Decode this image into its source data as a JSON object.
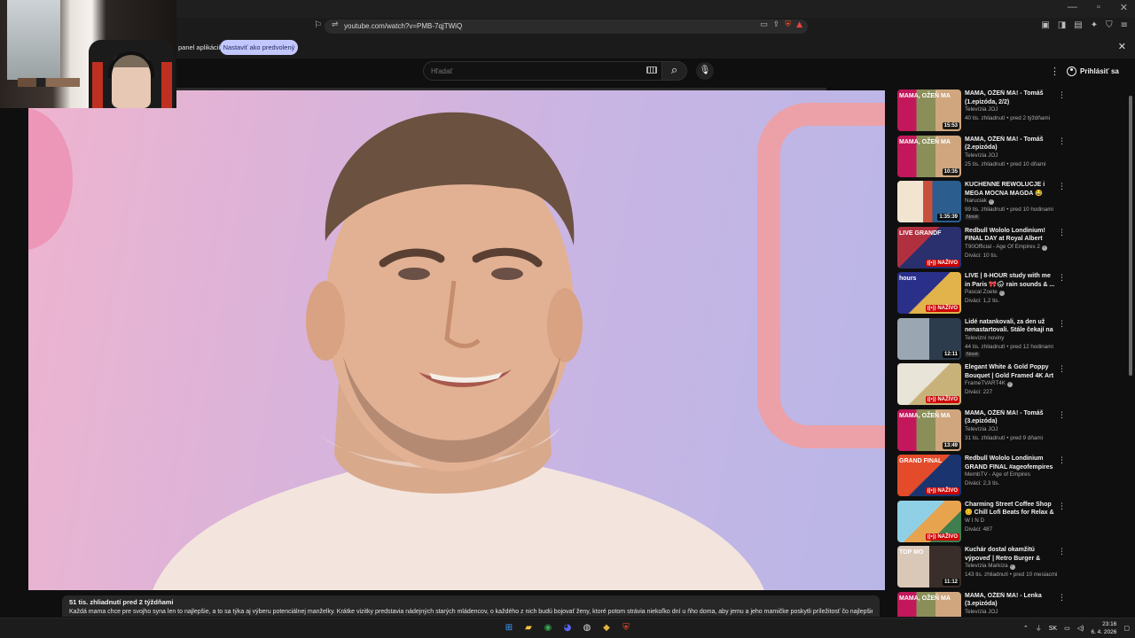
{
  "browser": {
    "window_controls": [
      "—",
      "▫",
      "✕"
    ],
    "url": "youtube.com/watch?v=PMB-7qjTWiQ",
    "infobar_text": "panel aplikácií",
    "infobar_button": "Nastaviť ako predvolený",
    "infobar_close": "✕"
  },
  "header": {
    "search_placeholder": "Hľadať",
    "search_icon": "⌕",
    "mic_icon": "🎙",
    "more_icon": "⋮",
    "signin_label": "Prihlásiť sa"
  },
  "player": {
    "progress": 0.0
  },
  "description": {
    "meta": "51 tis. zhliadnutí  pred 2 týždňami",
    "text": "Každá mama chce pre svojho syna len to najlepšie, a to sa týka aj výberu potenciálnej manželky. Krátke vizitky predstavia nádejných starých mládencov, o každého z nich budú bojovať ženy, ktoré potom strávia niekoľko dní u ňho doma, aby jemu a jeho mamičke poskytli príležitosť čo najlepšie"
  },
  "recommendations": [
    {
      "title": "MAMA, OŽEŇ MA! - Tomáš (1.epizóda, 2/2)",
      "channel": "Televízia JOJ",
      "verified": false,
      "meta": "40 tis. zhliadnutí • pred 2 týždňami",
      "duration": "15:53",
      "live": "",
      "badge": "",
      "thumb_style": "joj",
      "thumb_label": "MAMA, OŽEŇ MA"
    },
    {
      "title": "MAMA, OŽEŇ MA! - Tomáš (2.epizóda)",
      "channel": "Televízia JOJ",
      "verified": false,
      "meta": "25 tis. zhliadnutí • pred 10 dňami",
      "duration": "10:35",
      "live": "",
      "badge": "",
      "thumb_style": "joj",
      "thumb_label": "MAMA, OŽEŇ MA"
    },
    {
      "title": "KUCHENNE REWOLUCJE i MEGA MOCNA MAGDA 😂",
      "channel": "Naruciak",
      "verified": true,
      "meta": "99 tis. zhliadnutí • pred 10 hodinami",
      "duration": "1:35:39",
      "live": "",
      "badge": "Nové",
      "thumb_style": "kuchenne",
      "thumb_label": ""
    },
    {
      "title": "Redbull Wololo Londinium! FINAL DAY at Royal Albert Hall!",
      "channel": "T90Official - Age Of Empires 2",
      "verified": true,
      "meta": "Diváci: 10 tis.",
      "duration": "",
      "live": "((•)) NAŽIVO",
      "badge": "",
      "thumb_style": "redbull",
      "thumb_label": "LIVE GRANDF"
    },
    {
      "title": "LIVE | 8-HOUR study with me in Paris 🎀🌧 rain sounds & ...",
      "channel": "Pascal Zoete",
      "verified": true,
      "meta": "Diváci: 1,2 tis.",
      "duration": "",
      "live": "((•)) NAŽIVO",
      "badge": "",
      "thumb_style": "study",
      "thumb_label": "hours"
    },
    {
      "title": "Lidé natankovali, za den už nenastartovali. Stále čekají na ...",
      "channel": "Televizní noviny",
      "verified": false,
      "meta": "44 tis. zhliadnutí • pred 12 hodinami",
      "duration": "12:11",
      "live": "",
      "badge": "Nové",
      "thumb_style": "news",
      "thumb_label": ""
    },
    {
      "title": "Elegant White & Gold Poppy Bouquet | Gold Framed 4K Art ...",
      "channel": "FrameTVART4K",
      "verified": true,
      "meta": "Diváci: 227",
      "duration": "",
      "live": "((•)) NAŽIVO",
      "badge": "",
      "thumb_style": "poppy",
      "thumb_label": ""
    },
    {
      "title": "MAMA, OŽEŇ MA! - Tomáš (3.epizóda)",
      "channel": "Televízia JOJ",
      "verified": false,
      "meta": "31 tis. zhliadnutí • pred 9 dňami",
      "duration": "13:49",
      "live": "",
      "badge": "",
      "thumb_style": "joj",
      "thumb_label": "MAMA, OŽEŇ MA"
    },
    {
      "title": "Redbull Wololo Londinium GRAND FINAL #ageofempires",
      "channel": "MembTV - Age of Empires",
      "verified": false,
      "meta": "Diváci: 2,3 tis.",
      "duration": "",
      "live": "((•)) NAŽIVO",
      "badge": "",
      "thumb_style": "grandfinal",
      "thumb_label": "GRAND FINAL"
    },
    {
      "title": "Charming Street Coffee Shop 😊 Chill Lofi Beats for Relax & ...",
      "channel": "W I N D",
      "verified": false,
      "meta": "Diváci: 487",
      "duration": "",
      "live": "((•)) NAŽIVO",
      "badge": "",
      "thumb_style": "coffee",
      "thumb_label": ""
    },
    {
      "title": "Kuchár dostal okamžitú výpoveď | Retro Burger & Dinn...",
      "channel": "Televízia Markíza",
      "verified": true,
      "meta": "143 tis. zhliadnutí • pred 10 mesiacmi",
      "duration": "11:12",
      "live": "",
      "badge": "",
      "thumb_style": "markiza",
      "thumb_label": "TOP MO"
    },
    {
      "title": "MAMA, OŽEŇ MA! - Lenka (3.epizóda)",
      "channel": "Televízia JOJ",
      "verified": false,
      "meta": "",
      "duration": "",
      "live": "",
      "badge": "",
      "thumb_style": "joj",
      "thumb_label": "MAMA, OŽEŇ MA"
    }
  ],
  "taskbar": {
    "lang": "SK",
    "time": "23:16",
    "date": "6. 4. 2026"
  },
  "colors": {
    "yt_bg": "#0f0f0f",
    "live_badge": "#cc0000",
    "infobar_button_bg": "#c2c8ff"
  }
}
